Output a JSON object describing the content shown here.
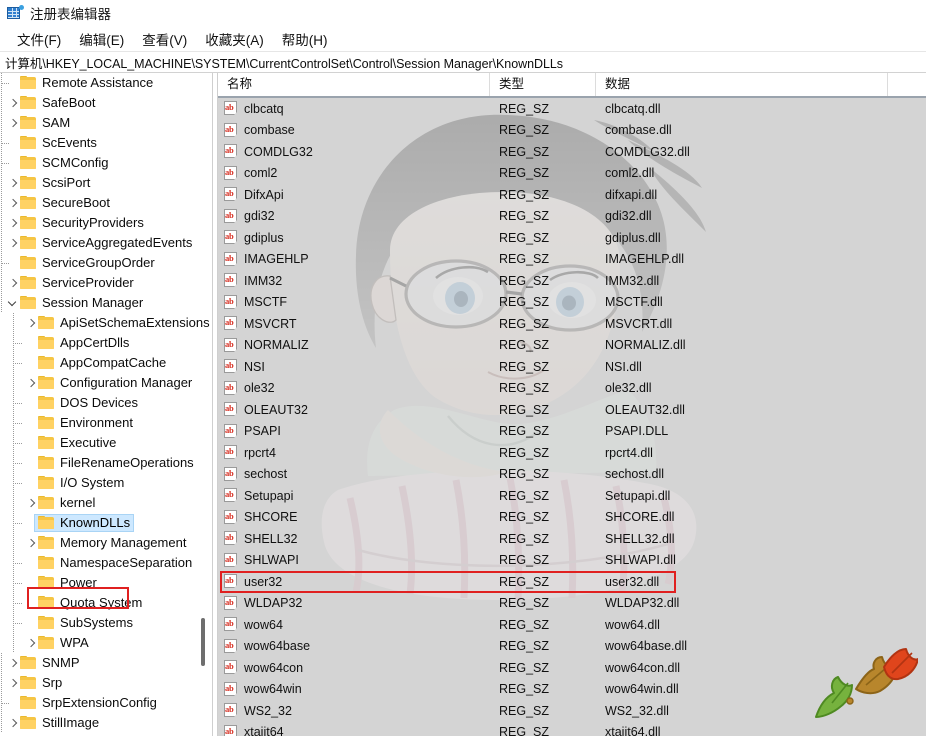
{
  "window": {
    "title": "注册表编辑器",
    "icon": "registry-editor-icon"
  },
  "menubar": {
    "items": [
      {
        "label": "文件(F)",
        "name": "menu-file"
      },
      {
        "label": "编辑(E)",
        "name": "menu-edit"
      },
      {
        "label": "查看(V)",
        "name": "menu-view"
      },
      {
        "label": "收藏夹(A)",
        "name": "menu-favorites"
      },
      {
        "label": "帮助(H)",
        "name": "menu-help"
      }
    ]
  },
  "address": {
    "path": "计算机\\HKEY_LOCAL_MACHINE\\SYSTEM\\CurrentControlSet\\Control\\Session Manager\\KnownDLLs"
  },
  "tree": {
    "items": [
      {
        "label": "Remote Assistance",
        "depth": 1,
        "chev": "none",
        "selected": false
      },
      {
        "label": "SafeBoot",
        "depth": 1,
        "chev": "collapsed",
        "selected": false
      },
      {
        "label": "SAM",
        "depth": 1,
        "chev": "collapsed",
        "selected": false
      },
      {
        "label": "ScEvents",
        "depth": 1,
        "chev": "none",
        "selected": false
      },
      {
        "label": "SCMConfig",
        "depth": 1,
        "chev": "none",
        "selected": false
      },
      {
        "label": "ScsiPort",
        "depth": 1,
        "chev": "collapsed",
        "selected": false
      },
      {
        "label": "SecureBoot",
        "depth": 1,
        "chev": "collapsed",
        "selected": false
      },
      {
        "label": "SecurityProviders",
        "depth": 1,
        "chev": "collapsed",
        "selected": false
      },
      {
        "label": "ServiceAggregatedEvents",
        "depth": 1,
        "chev": "collapsed",
        "selected": false
      },
      {
        "label": "ServiceGroupOrder",
        "depth": 1,
        "chev": "none",
        "selected": false
      },
      {
        "label": "ServiceProvider",
        "depth": 1,
        "chev": "collapsed",
        "selected": false
      },
      {
        "label": "Session Manager",
        "depth": 1,
        "chev": "expanded",
        "selected": false
      },
      {
        "label": "ApiSetSchemaExtensions",
        "depth": 2,
        "chev": "collapsed",
        "selected": false
      },
      {
        "label": "AppCertDlls",
        "depth": 2,
        "chev": "none",
        "selected": false
      },
      {
        "label": "AppCompatCache",
        "depth": 2,
        "chev": "none",
        "selected": false
      },
      {
        "label": "Configuration Manager",
        "depth": 2,
        "chev": "collapsed",
        "selected": false
      },
      {
        "label": "DOS Devices",
        "depth": 2,
        "chev": "none",
        "selected": false
      },
      {
        "label": "Environment",
        "depth": 2,
        "chev": "none",
        "selected": false
      },
      {
        "label": "Executive",
        "depth": 2,
        "chev": "none",
        "selected": false
      },
      {
        "label": "FileRenameOperations",
        "depth": 2,
        "chev": "none",
        "selected": false
      },
      {
        "label": "I/O System",
        "depth": 2,
        "chev": "none",
        "selected": false
      },
      {
        "label": "kernel",
        "depth": 2,
        "chev": "collapsed",
        "selected": false
      },
      {
        "label": "KnownDLLs",
        "depth": 2,
        "chev": "none",
        "selected": true
      },
      {
        "label": "Memory Management",
        "depth": 2,
        "chev": "collapsed",
        "selected": false
      },
      {
        "label": "NamespaceSeparation",
        "depth": 2,
        "chev": "none",
        "selected": false
      },
      {
        "label": "Power",
        "depth": 2,
        "chev": "none",
        "selected": false
      },
      {
        "label": "Quota System",
        "depth": 2,
        "chev": "none",
        "selected": false
      },
      {
        "label": "SubSystems",
        "depth": 2,
        "chev": "none",
        "selected": false
      },
      {
        "label": "WPA",
        "depth": 2,
        "chev": "collapsed",
        "selected": false
      },
      {
        "label": "SNMP",
        "depth": 1,
        "chev": "collapsed",
        "selected": false
      },
      {
        "label": "Srp",
        "depth": 1,
        "chev": "collapsed",
        "selected": false
      },
      {
        "label": "SrpExtensionConfig",
        "depth": 1,
        "chev": "none",
        "selected": false
      },
      {
        "label": "StillImage",
        "depth": 1,
        "chev": "collapsed",
        "selected": false
      }
    ],
    "highlight": "KnownDLLs",
    "highlight_color": "#e02020",
    "selection_color": "#cde8ff"
  },
  "list": {
    "columns": [
      {
        "label": "名称",
        "name": "column-name"
      },
      {
        "label": "类型",
        "name": "column-type"
      },
      {
        "label": "数据",
        "name": "column-data"
      }
    ],
    "value_icon": "ab-string-value-icon",
    "highlight_row": "user32",
    "highlight_color": "#e02020",
    "rows": [
      {
        "name": "clbcatq",
        "type": "REG_SZ",
        "data": "clbcatq.dll"
      },
      {
        "name": "combase",
        "type": "REG_SZ",
        "data": "combase.dll"
      },
      {
        "name": "COMDLG32",
        "type": "REG_SZ",
        "data": "COMDLG32.dll"
      },
      {
        "name": "coml2",
        "type": "REG_SZ",
        "data": "coml2.dll"
      },
      {
        "name": "DifxApi",
        "type": "REG_SZ",
        "data": "difxapi.dll"
      },
      {
        "name": "gdi32",
        "type": "REG_SZ",
        "data": "gdi32.dll"
      },
      {
        "name": "gdiplus",
        "type": "REG_SZ",
        "data": "gdiplus.dll"
      },
      {
        "name": "IMAGEHLP",
        "type": "REG_SZ",
        "data": "IMAGEHLP.dll"
      },
      {
        "name": "IMM32",
        "type": "REG_SZ",
        "data": "IMM32.dll"
      },
      {
        "name": "MSCTF",
        "type": "REG_SZ",
        "data": "MSCTF.dll"
      },
      {
        "name": "MSVCRT",
        "type": "REG_SZ",
        "data": "MSVCRT.dll"
      },
      {
        "name": "NORMALIZ",
        "type": "REG_SZ",
        "data": "NORMALIZ.dll"
      },
      {
        "name": "NSI",
        "type": "REG_SZ",
        "data": "NSI.dll"
      },
      {
        "name": "ole32",
        "type": "REG_SZ",
        "data": "ole32.dll"
      },
      {
        "name": "OLEAUT32",
        "type": "REG_SZ",
        "data": "OLEAUT32.dll"
      },
      {
        "name": "PSAPI",
        "type": "REG_SZ",
        "data": "PSAPI.DLL"
      },
      {
        "name": "rpcrt4",
        "type": "REG_SZ",
        "data": "rpcrt4.dll"
      },
      {
        "name": "sechost",
        "type": "REG_SZ",
        "data": "sechost.dll"
      },
      {
        "name": "Setupapi",
        "type": "REG_SZ",
        "data": "Setupapi.dll"
      },
      {
        "name": "SHCORE",
        "type": "REG_SZ",
        "data": "SHCORE.dll"
      },
      {
        "name": "SHELL32",
        "type": "REG_SZ",
        "data": "SHELL32.dll"
      },
      {
        "name": "SHLWAPI",
        "type": "REG_SZ",
        "data": "SHLWAPI.dll"
      },
      {
        "name": "user32",
        "type": "REG_SZ",
        "data": "user32.dll"
      },
      {
        "name": "WLDAP32",
        "type": "REG_SZ",
        "data": "WLDAP32.dll"
      },
      {
        "name": "wow64",
        "type": "REG_SZ",
        "data": "wow64.dll"
      },
      {
        "name": "wow64base",
        "type": "REG_SZ",
        "data": "wow64base.dll"
      },
      {
        "name": "wow64con",
        "type": "REG_SZ",
        "data": "wow64con.dll"
      },
      {
        "name": "wow64win",
        "type": "REG_SZ",
        "data": "wow64win.dll"
      },
      {
        "name": "WS2_32",
        "type": "REG_SZ",
        "data": "WS2_32.dll"
      },
      {
        "name": "xtajit64",
        "type": "REG_SZ",
        "data": "xtajit64.dll"
      }
    ]
  }
}
